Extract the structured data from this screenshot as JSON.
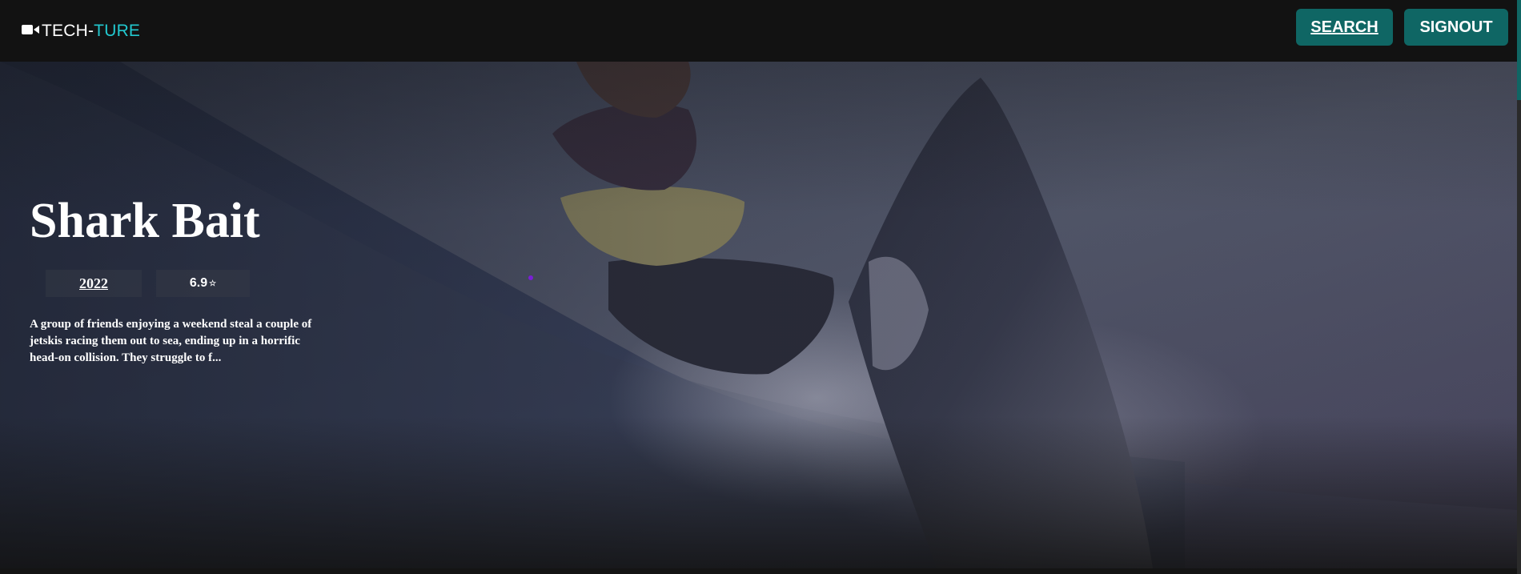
{
  "navbar": {
    "logo_prefix": "TECH-",
    "logo_suffix": "TURE",
    "logo_icon": "video-camera-icon",
    "search_label": "SEARCH",
    "signout_label": "SIGNOUT"
  },
  "hero": {
    "title": "Shark Bait",
    "year": "2022",
    "rating": "6.9",
    "rating_icon": "star-icon",
    "overview": "A group of friends enjoying a weekend steal a couple of jetskis racing them out to sea, ending up in a horrific head-on collision. They struggle to f..."
  },
  "colors": {
    "accent": "#22c8cf",
    "button": "#0f6664",
    "navbar_bg": "#121212"
  }
}
